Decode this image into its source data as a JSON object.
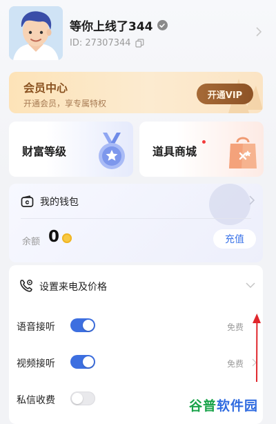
{
  "profile": {
    "nickname": "等你上线了344",
    "id_text": "ID: 27307344"
  },
  "vip": {
    "title": "会员中心",
    "subtitle": "开通会员，享专属特权",
    "button_label": "开通VIP"
  },
  "tiles": {
    "wealth_label": "财富等级",
    "store_label": "道具商城"
  },
  "wallet": {
    "title": "我的钱包",
    "balance_label": "余额",
    "balance_value": "0",
    "recharge_label": "充值"
  },
  "settings": {
    "title": "设置来电及价格",
    "rows": [
      {
        "label": "语音接听",
        "enabled": true,
        "value": "免费"
      },
      {
        "label": "视频接听",
        "enabled": true,
        "value": "免费"
      },
      {
        "label": "私信收费",
        "enabled": false,
        "value": ""
      }
    ]
  },
  "watermark": {
    "part_a": "谷普",
    "part_b": "软件园"
  },
  "icons": {
    "verified": "verified-badge-icon",
    "copy": "copy-icon",
    "medal": "medal-icon",
    "bag": "shopping-bag-icon",
    "wallet": "wallet-icon",
    "coin": "coin-icon",
    "phone": "phone-settings-icon"
  },
  "colors": {
    "accent_blue": "#3d6fe0",
    "vip_brown": "#8d5326",
    "vip_bg": "#fde3b8",
    "badge_red": "#f23b3b",
    "annotation_red": "#e0262c"
  }
}
